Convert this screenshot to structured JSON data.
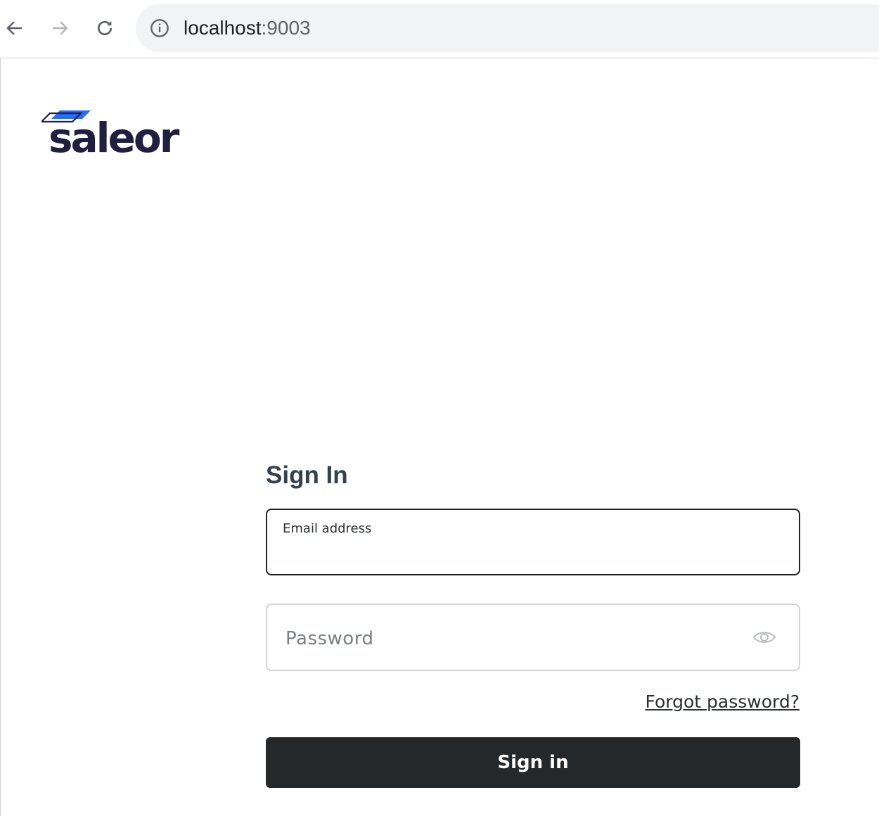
{
  "browser": {
    "url_host": "localhost",
    "url_port": ":9003",
    "icons": {
      "back": "arrow-left-icon",
      "forward": "arrow-right-icon",
      "reload": "reload-icon",
      "site_info": "info-icon"
    }
  },
  "brand": {
    "logo_text": "saleor",
    "colors": {
      "logo_dark": "#201f3d",
      "logo_accent": "#2b6cf6"
    }
  },
  "login": {
    "title": "Sign In",
    "email_label": "Email address",
    "email_value": "",
    "password_placeholder": "Password",
    "password_value": "",
    "forgot_password_label": "Forgot password?",
    "sign_in_button_label": "Sign in",
    "colors": {
      "title": "#34404f",
      "button_bg": "#25282a",
      "button_text": "#ffffff"
    }
  }
}
